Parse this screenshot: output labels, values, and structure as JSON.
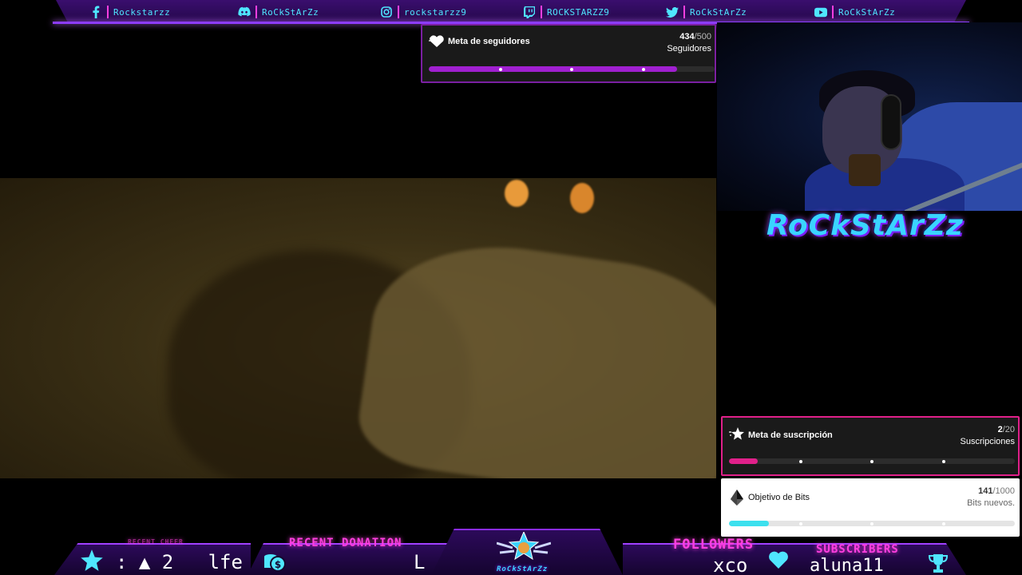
{
  "social": [
    {
      "icon": "facebook-icon",
      "handle": "Rockstarzz"
    },
    {
      "icon": "discord-icon",
      "handle": "RoCkStArZz"
    },
    {
      "icon": "instagram-icon",
      "handle": "rockstarzz9"
    },
    {
      "icon": "twitch-icon",
      "handle": "ROCKSTARZZ9"
    },
    {
      "icon": "twitter-icon",
      "handle": "RoCkStArZz"
    },
    {
      "icon": "youtube-icon",
      "handle": "RoCkStArZz"
    }
  ],
  "follower_goal": {
    "title": "Meta de seguidores",
    "current": "434",
    "total": "/500",
    "unit": "Seguidores",
    "progress": 0.868,
    "color": "#a020d0"
  },
  "sub_goal": {
    "title": "Meta de suscripción",
    "current": "2",
    "total": "/20",
    "unit": "Suscripciones",
    "progress": 0.1,
    "color": "#e0208a"
  },
  "bits_goal": {
    "title": "Objetivo de Bits",
    "current": "141",
    "total": "/1000",
    "unit": "Bits nuevos.",
    "progress": 0.141,
    "color": "#3ce0ee"
  },
  "channel_logo": "RoCkStArZz",
  "bottom": {
    "recent_cheer_label": "RECENT CHEER",
    "recent_cheer_value": ": ▲ 2   lfe",
    "recent_donation_label": "RECENT DONATION",
    "recent_donation_value": "L",
    "center_logo": "RoCkStArZz",
    "followers_label": "FOLLOWERS",
    "followers_value": "xco",
    "subscribers_label": "SUBSCRIBERS",
    "subscribers_value": "aluna11"
  },
  "colors": {
    "accent_cyan": "#4fe6ff",
    "accent_pink": "#ff3fe0",
    "accent_purple": "#8d3cff"
  }
}
